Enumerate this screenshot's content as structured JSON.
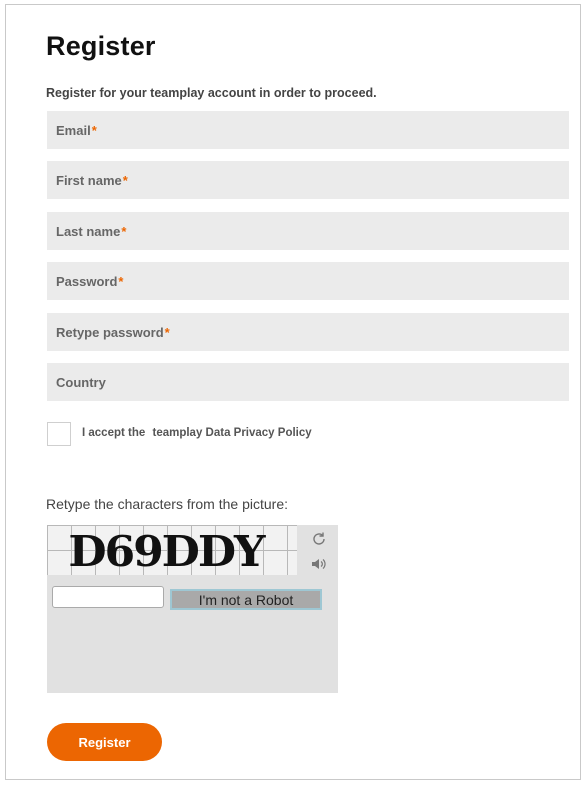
{
  "form": {
    "title": "Register",
    "subtitle": "Register for your teamplay account in order to proceed.",
    "required_marker": "*",
    "accent_color": "#ec6602",
    "fields": [
      {
        "label": "Email",
        "required": true
      },
      {
        "label": "First name",
        "required": true
      },
      {
        "label": "Last name",
        "required": true
      },
      {
        "label": "Password",
        "required": true
      },
      {
        "label": "Retype password",
        "required": true
      },
      {
        "label": "Country",
        "required": false
      }
    ],
    "privacy": {
      "prefix": "I accept the",
      "link": "teamplay Data Privacy Policy",
      "checked": false
    }
  },
  "captcha": {
    "label": "Retype the characters from the picture:",
    "image_text": "D69DDY",
    "refresh_icon": "refresh-icon",
    "audio_icon": "speaker-icon",
    "robot_button": "I'm not a Robot",
    "input_value": ""
  },
  "actions": {
    "register": "Register"
  }
}
